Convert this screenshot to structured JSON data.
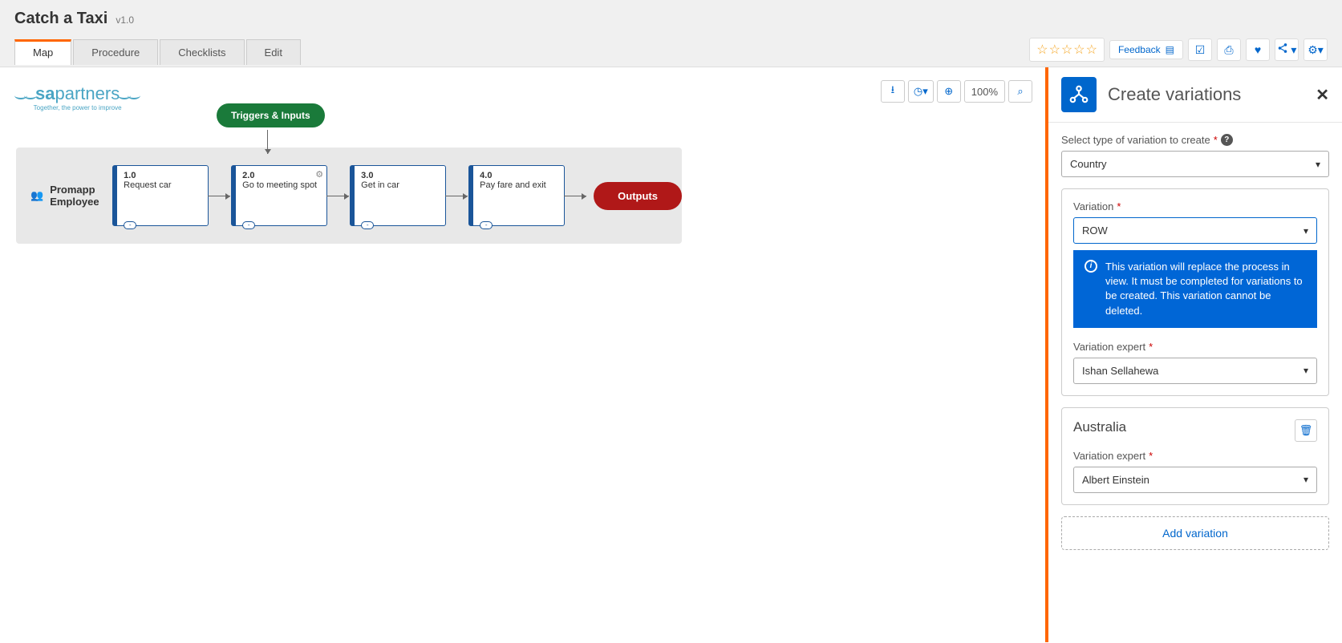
{
  "header": {
    "title": "Catch a Taxi",
    "version": "v1.0",
    "tabs": [
      "Map",
      "Procedure",
      "Checklists",
      "Edit"
    ],
    "feedback_label": "Feedback"
  },
  "canvas": {
    "zoom": "100%",
    "logo": {
      "brand_a": "sa",
      "brand_b": "partners",
      "tagline": "Together, the power to improve"
    },
    "lane_label": "Promapp Employee",
    "trigger_label": "Triggers & Inputs",
    "outputs_label": "Outputs",
    "steps": [
      {
        "num": "1.0",
        "title": "Request car",
        "gear": false
      },
      {
        "num": "2.0",
        "title": "Go to meeting spot",
        "gear": true
      },
      {
        "num": "3.0",
        "title": "Get in car",
        "gear": false
      },
      {
        "num": "4.0",
        "title": "Pay fare and exit",
        "gear": false
      }
    ]
  },
  "panel": {
    "title": "Create variations",
    "type_label": "Select type of variation to create",
    "type_value": "Country",
    "variation_label": "Variation",
    "variation_value": "ROW",
    "info_text": "This variation will replace the process in view. It must be completed for variations to be created. This variation cannot be deleted.",
    "expert_label": "Variation expert",
    "expert1_value": "Ishan Sellahewa",
    "var2_name": "Australia",
    "expert2_value": "Albert Einstein",
    "add_label": "Add variation"
  }
}
